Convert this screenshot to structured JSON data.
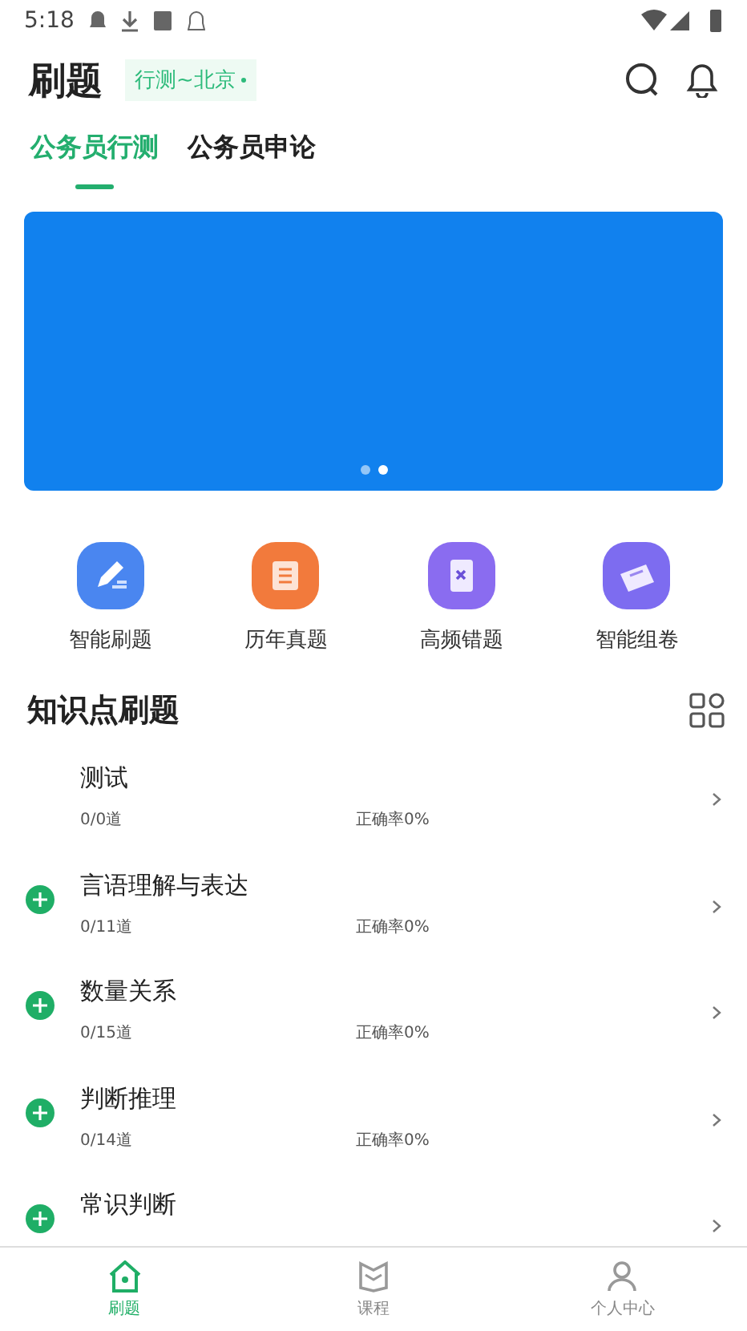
{
  "status_bar": {
    "time": "5:18"
  },
  "header": {
    "title": "刷题",
    "exam_selector": "行测~北京"
  },
  "tabs": [
    {
      "label": "公务员行测",
      "selected": true
    },
    {
      "label": "公务员申论",
      "selected": false
    }
  ],
  "banner": {
    "pages": [
      {
        "selected": false
      },
      {
        "selected": true
      }
    ]
  },
  "shortcuts": [
    {
      "label": "智能刷题",
      "kind": "pencil",
      "color": "#4a86f0"
    },
    {
      "label": "历年真题",
      "kind": "scroll",
      "color": "#f27a3c"
    },
    {
      "label": "高频错题",
      "kind": "book",
      "color": "#8a6cf0"
    },
    {
      "label": "智能组卷",
      "kind": "paper",
      "color": "#7d6cf0"
    }
  ],
  "section": {
    "title": "知识点刷题"
  },
  "topics": [
    {
      "name": "测试",
      "expandable": false,
      "count": "0/0道",
      "accuracy": "正确率0%"
    },
    {
      "name": "言语理解与表达",
      "expandable": true,
      "count": "0/11道",
      "accuracy": "正确率0%"
    },
    {
      "name": "数量关系",
      "expandable": true,
      "count": "0/15道",
      "accuracy": "正确率0%"
    },
    {
      "name": "判断推理",
      "expandable": true,
      "count": "0/14道",
      "accuracy": "正确率0%"
    },
    {
      "name": "常识判断",
      "expandable": true
    }
  ],
  "bottom_nav": [
    {
      "label": "刷题",
      "kind": "home",
      "selected": true
    },
    {
      "label": "课程",
      "kind": "course",
      "selected": false
    },
    {
      "label": "个人中心",
      "kind": "person",
      "selected": false
    }
  ]
}
